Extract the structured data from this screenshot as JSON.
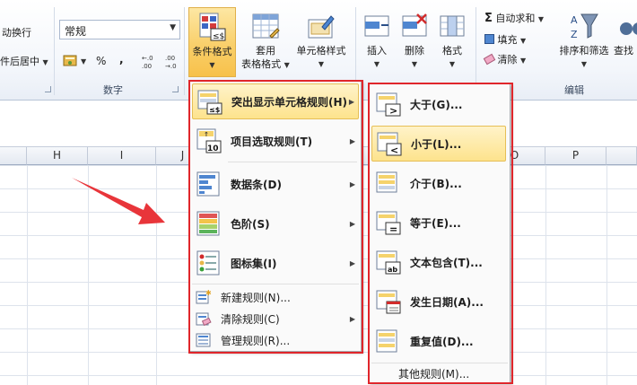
{
  "ribbon": {
    "alignment_partial": {
      "wrap": "动换行",
      "merge": "件后居中"
    },
    "number": {
      "format_value": "常规",
      "group_label": "数字",
      "percent": "%",
      "comma": ","
    },
    "styles": {
      "conditional_format": "条件格式",
      "table_format_top": "套用",
      "table_format_bottom": "表格格式",
      "cell_style": "单元格样式"
    },
    "cells": {
      "insert": "插入",
      "delete": "删除",
      "format": "格式"
    },
    "editing": {
      "autosum": "自动求和",
      "fill": "填充",
      "clear": "清除",
      "sort_filter": "排序和筛选",
      "find_partial": "查找",
      "group_label": "编辑"
    }
  },
  "columns": [
    "H",
    "I",
    "J",
    "O",
    "P"
  ],
  "main_menu": {
    "items": [
      {
        "label": "突出显示单元格规则(H)",
        "icon": "highlight-rules-icon"
      },
      {
        "label": "项目选取规则(T)",
        "icon": "top-bottom-rules-icon"
      },
      {
        "label": "数据条(D)",
        "icon": "data-bars-icon"
      },
      {
        "label": "色阶(S)",
        "icon": "color-scales-icon"
      },
      {
        "label": "图标集(I)",
        "icon": "icon-sets-icon"
      }
    ],
    "small_items": [
      {
        "label": "新建规则(N)...",
        "icon": "new-rule-icon"
      },
      {
        "label": "清除规则(C)",
        "icon": "clear-rules-icon"
      },
      {
        "label": "管理规则(R)...",
        "icon": "manage-rules-icon"
      }
    ]
  },
  "sub_menu": {
    "items": [
      {
        "label": "大于(G)...",
        "icon": "greater-than-icon"
      },
      {
        "label": "小于(L)...",
        "icon": "less-than-icon"
      },
      {
        "label": "介于(B)...",
        "icon": "between-icon"
      },
      {
        "label": "等于(E)...",
        "icon": "equal-to-icon"
      },
      {
        "label": "文本包含(T)...",
        "icon": "text-contains-icon"
      },
      {
        "label": "发生日期(A)...",
        "icon": "date-occurring-icon"
      },
      {
        "label": "重复值(D)...",
        "icon": "duplicate-values-icon"
      }
    ],
    "more": "其他规则(M)..."
  },
  "colors": {
    "highlight": "#fde38d",
    "red_frame": "#e0262b",
    "arrow": "#e8353a"
  }
}
